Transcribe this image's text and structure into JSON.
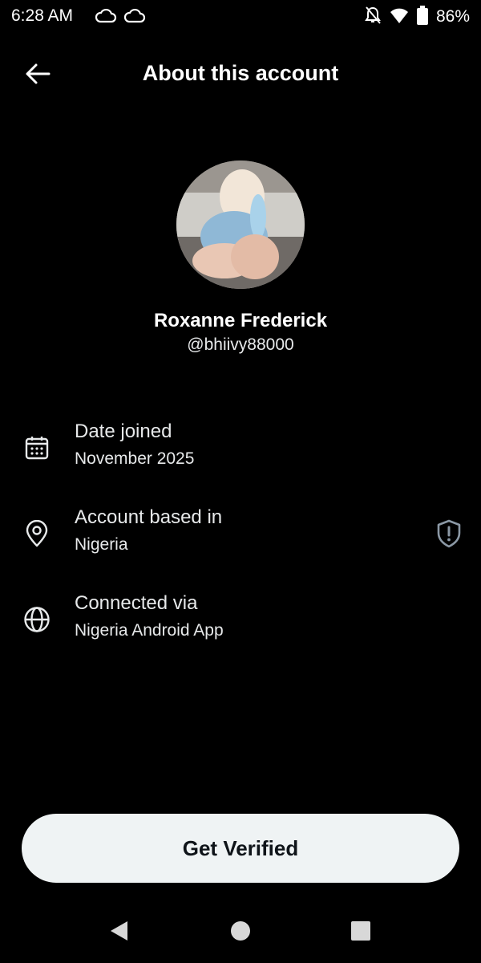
{
  "status_bar": {
    "time": "6:28 AM",
    "battery": "86%",
    "icons": [
      "cloud-icon",
      "cloud-icon",
      "notifications-off-icon",
      "wifi-icon",
      "battery-icon"
    ]
  },
  "header": {
    "title": "About this account",
    "back_icon": "arrow-left-icon"
  },
  "profile": {
    "display_name": "Roxanne Frederick",
    "handle": "@bhiivy88000"
  },
  "details": [
    {
      "icon": "calendar-icon",
      "title": "Date joined",
      "value": "November 2025"
    },
    {
      "icon": "location-pin-icon",
      "title": "Account based in",
      "value": "Nigeria",
      "action_icon": "shield-alert-icon"
    },
    {
      "icon": "globe-icon",
      "title": "Connected via",
      "value": "Nigeria Android App"
    }
  ],
  "cta": {
    "label": "Get Verified"
  },
  "nav_bar": {
    "icons": [
      "back-triangle-icon",
      "home-circle-icon",
      "recents-square-icon"
    ]
  },
  "colors": {
    "background": "#000000",
    "text": "#e7e9ea",
    "button_bg": "#eff3f4",
    "button_text": "#0f1419",
    "icon_muted": "#8b98a5"
  }
}
